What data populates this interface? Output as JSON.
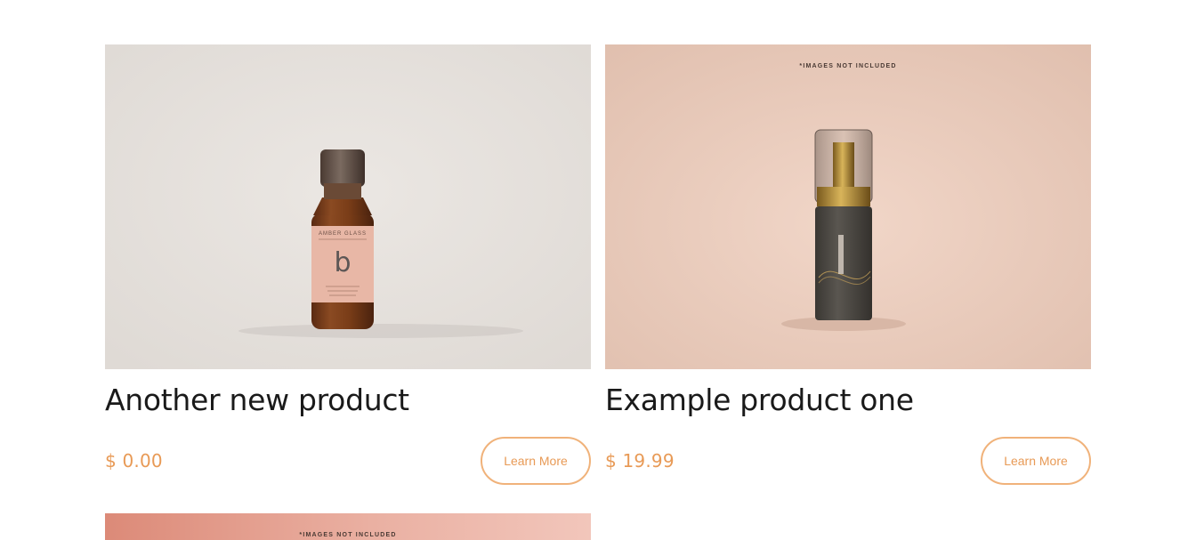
{
  "products": [
    {
      "title": "Another new product",
      "price": "$ 0.00",
      "button_label": "Learn More",
      "label_brand": "AMBER GLASS",
      "label_letter": "b",
      "image_bg": "#e6e2de"
    },
    {
      "title": "Example product one",
      "price": "$ 19.99",
      "button_label": "Learn More",
      "image_note": "*IMAGES NOT INCLUDED",
      "image_bg": "#e6c4b2"
    },
    {
      "image_note": "*IMAGES NOT INCLUDED",
      "image_bg": "#e49b8a"
    }
  ],
  "colors": {
    "accent": "#e89a56",
    "button_border": "#f0b27a",
    "title": "#1a1a1a"
  }
}
